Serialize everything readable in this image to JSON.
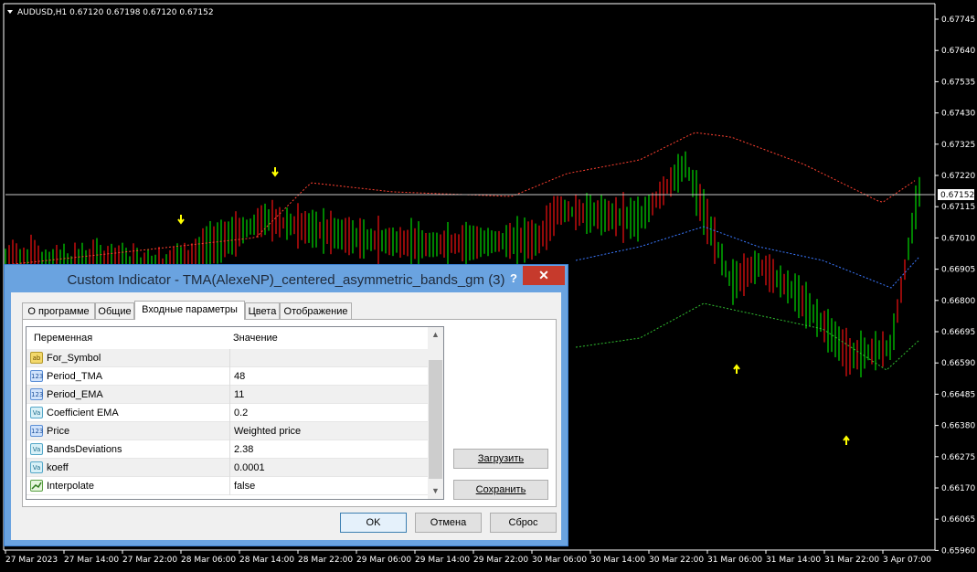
{
  "chart": {
    "info": "AUDUSD,H1  0.67120 0.67198 0.67120 0.67152",
    "current_price": "0.67152",
    "price_ticks": [
      "0.67745",
      "0.67640",
      "0.67535",
      "0.67430",
      "0.67325",
      "0.67220",
      "0.67115",
      "0.67010",
      "0.66905",
      "0.66800",
      "0.66695",
      "0.66590",
      "0.66485",
      "0.66380",
      "0.66275",
      "0.66170",
      "0.66065",
      "0.65960"
    ],
    "time_ticks": [
      "27 Mar 2023",
      "27 Mar 14:00",
      "27 Mar 22:00",
      "28 Mar 06:00",
      "28 Mar 14:00",
      "28 Mar 22:00",
      "29 Mar 06:00",
      "29 Mar 14:00",
      "29 Mar 22:00",
      "30 Mar 06:00",
      "30 Mar 14:00",
      "30 Mar 22:00",
      "31 Mar 06:00",
      "31 Mar 14:00",
      "31 Mar 22:00",
      "3 Apr 07:00"
    ],
    "colors": {
      "bull": "#00c800",
      "bear": "#e01010",
      "upper_band": "#ff4030",
      "middle_band": "#3a78ff",
      "lower_band": "#30c030",
      "arrow": "#ffff00",
      "price_line": "#c0c0c0"
    }
  },
  "dialog": {
    "title": "Custom Indicator - TMA(AlexeNP)_centered_asymmetric_bands_gm (3)",
    "help": "?",
    "close": "✕",
    "tabs": [
      "О программе",
      "Общие",
      "Входные параметры",
      "Цвета",
      "Отображение"
    ],
    "active_tab": "Входные параметры",
    "grid": {
      "col_variable": "Переменная",
      "col_value": "Значение",
      "rows": [
        {
          "icon": "ab",
          "name": "For_Symbol",
          "value": ""
        },
        {
          "icon": "123",
          "name": "Period_TMA",
          "value": "48"
        },
        {
          "icon": "123",
          "name": "Period_EMA",
          "value": "11"
        },
        {
          "icon": "Va",
          "name": "Coefficient EMA",
          "value": "0.2"
        },
        {
          "icon": "123",
          "name": "Price",
          "value": "Weighted price"
        },
        {
          "icon": "Va",
          "name": "BandsDeviations",
          "value": "2.38"
        },
        {
          "icon": "Va",
          "name": "koeff",
          "value": "0.0001"
        },
        {
          "icon": "bool",
          "name": "Interpolate",
          "value": "false"
        }
      ]
    },
    "load_button": "Загрузить",
    "save_button": "Сохранить",
    "ok_button": "OK",
    "cancel_button": "Отмена",
    "reset_button": "Сброс"
  }
}
